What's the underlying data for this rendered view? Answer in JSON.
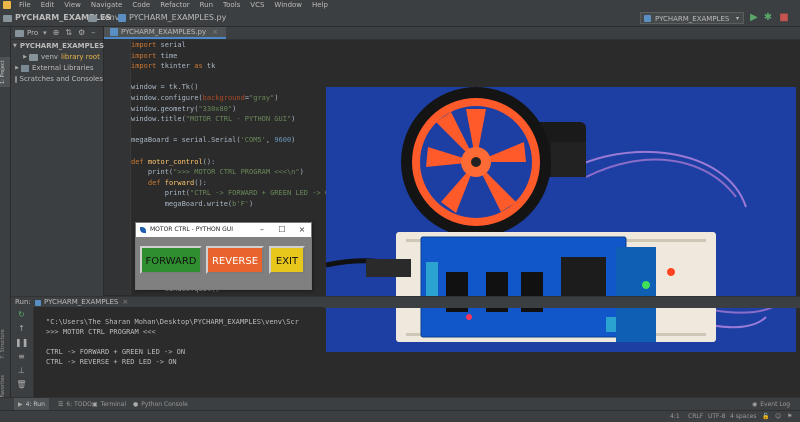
{
  "menu": [
    "File",
    "Edit",
    "View",
    "Navigate",
    "Code",
    "Refactor",
    "Run",
    "Tools",
    "VCS",
    "Window",
    "Help"
  ],
  "breadcrumb": {
    "project": "PYCHARM_EXAMPLES",
    "folder": "venv",
    "file": "PYCHARM_EXAMPLES.py"
  },
  "toolbar": {
    "run_config": "PYCHARM_EXAMPLES"
  },
  "left_stripe": {
    "project_tab": "1: Project",
    "structure_tab": "7: Structure",
    "favorites_tab": "2: Favorites"
  },
  "project_panel": {
    "label": "Pro",
    "items": [
      {
        "label": "PYCHARM_EXAMPLES",
        "indent": 0,
        "type": "folder"
      },
      {
        "label": "venv",
        "extra": "library root",
        "indent": 1,
        "type": "folder"
      },
      {
        "label": "External Libraries",
        "indent": 0,
        "type": "lib"
      },
      {
        "label": "Scratches and Consoles",
        "indent": 0,
        "type": "scratch"
      }
    ]
  },
  "editor": {
    "tab": "PYCHARM_EXAMPLES.py"
  },
  "tk_window": {
    "title": "MOTOR CTRL - PYTHON GUI",
    "buttons": [
      {
        "label": "FORWARD",
        "color": "#2f8f2f"
      },
      {
        "label": "REVERSE",
        "color": "#e9632d"
      },
      {
        "label": "EXIT",
        "color": "#e7c71b"
      }
    ]
  },
  "run_panel": {
    "label": "Run:",
    "config": "PYCHARM_EXAMPLES",
    "lines": [
      "\"C:\\Users\\The Sharan Mohan\\Desktop\\PYCHARM_EXAMPLES\\venv\\Scr",
      ">>> MOTOR CTRL PROGRAM <<<",
      "",
      "CTRL -> FORWARD + GREEN LED -> ON",
      "CTRL -> REVERSE + RED LED -> ON"
    ]
  },
  "bottom_tabs": [
    "4: Run",
    "6: TODO",
    "Terminal",
    "Python Console"
  ],
  "event_log": "Event Log",
  "status": {
    "position": "4:1",
    "line_sep": "CRLF",
    "encoding": "UTF-8",
    "indent": "4 spaces"
  },
  "colors": {
    "ide_bg": "#2b2b2b",
    "panel": "#3c3f41",
    "keyword": "#cc7832",
    "string": "#6a8759",
    "number": "#6897bb",
    "photo_bg": "#1d3fa3"
  }
}
